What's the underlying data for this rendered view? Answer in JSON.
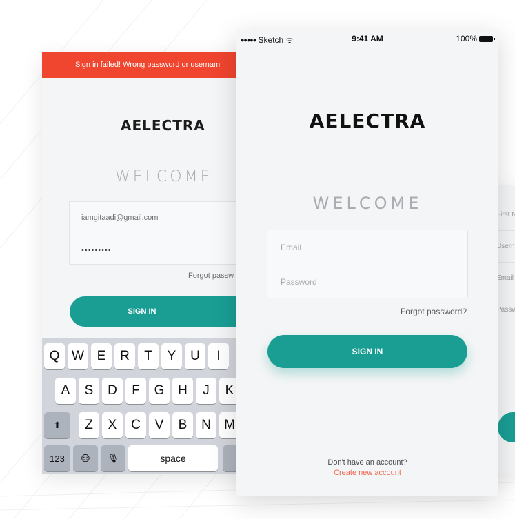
{
  "left_screen": {
    "error_banner": "Sign in failed! Wrong password or usernam",
    "logo": "AELECTRA",
    "welcome": "WELCOME",
    "email_value": "iamgitaadi@gmail.com",
    "password_value": "•••••••••",
    "forgot": "Forgot passw",
    "signin": "SIGN IN",
    "keyboard": {
      "row1": [
        "Q",
        "W",
        "E",
        "R",
        "T",
        "Y",
        "U",
        "I"
      ],
      "row2": [
        "A",
        "S",
        "D",
        "F",
        "G",
        "H",
        "J",
        "K"
      ],
      "row3": [
        "Z",
        "X",
        "C",
        "V",
        "B",
        "N",
        "M"
      ],
      "shift": "⬆",
      "numbers": "123",
      "emoji": "☺",
      "mic": "🎙",
      "space": "space"
    }
  },
  "right_screen": {
    "fields": [
      "First N",
      "Userna",
      "Email",
      "Passw"
    ]
  },
  "phone": {
    "status": {
      "carrier": "Sketch",
      "dots": "●●●●●",
      "wifi": "ᯤ",
      "time": "9:41 AM",
      "battery": "100%"
    },
    "logo": "AELECTRA",
    "welcome": "WELCOME",
    "email_placeholder": "Email",
    "password_placeholder": "Password",
    "forgot": "Forgot password?",
    "signin": "SIGN IN",
    "no_account": "Don't have an account?",
    "create_account": "Create new account"
  },
  "colors": {
    "accent": "#1a9e94",
    "error": "#f0452f",
    "link": "#f0654f"
  }
}
